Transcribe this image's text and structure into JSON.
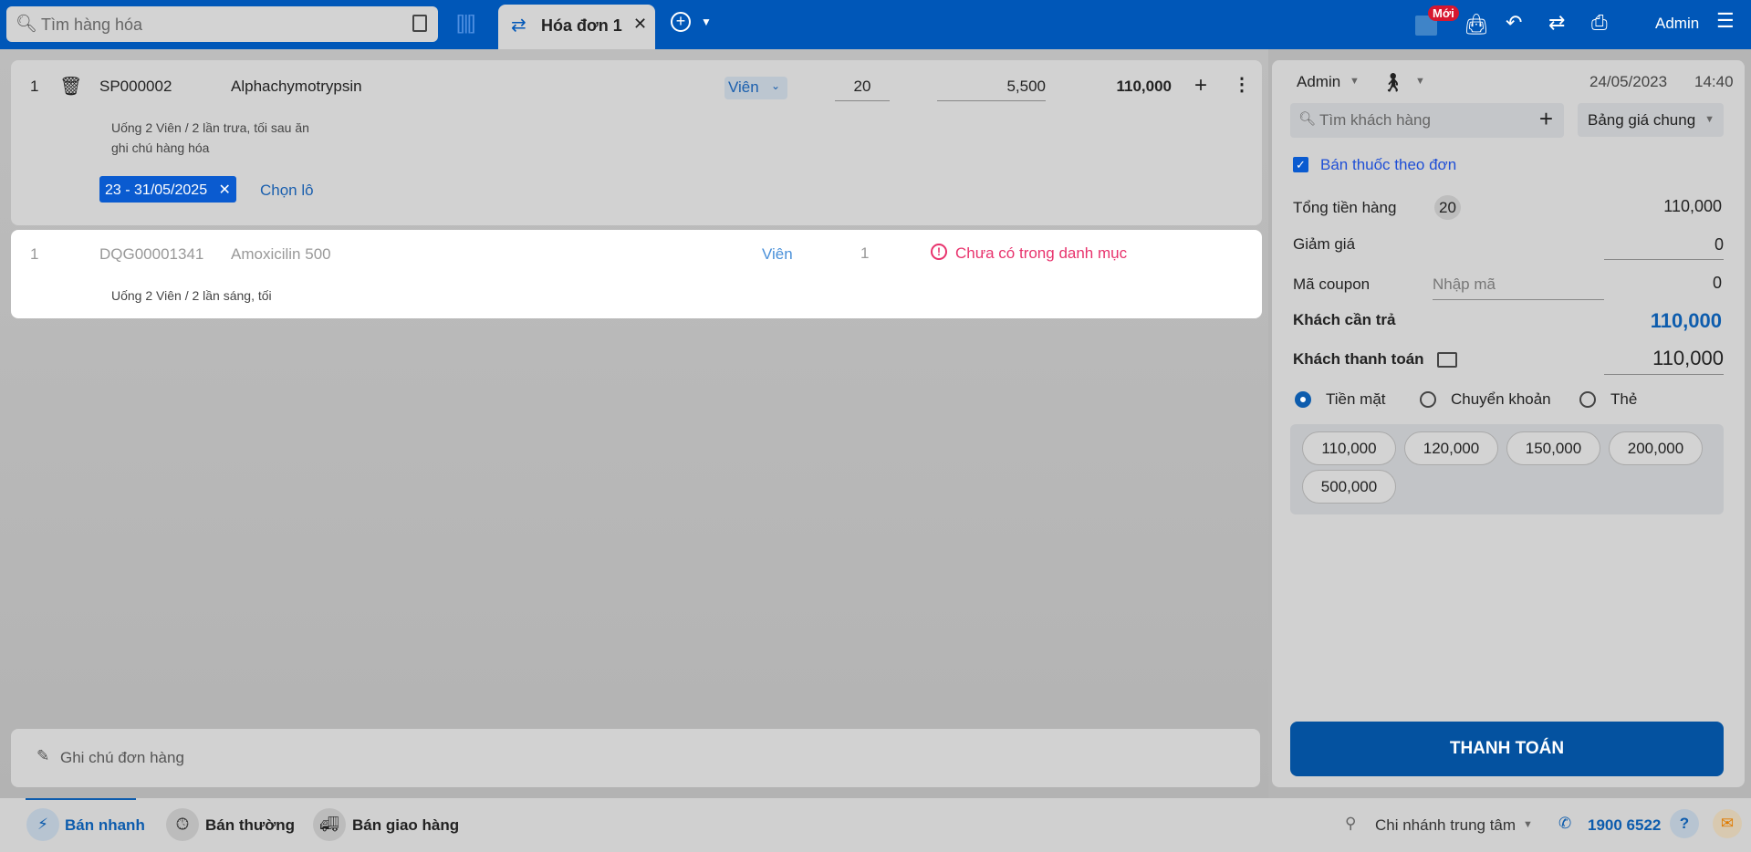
{
  "topbar": {
    "search_placeholder": "Tìm hàng hóa",
    "tab_label": "Hóa đơn 1",
    "new_badge": "Mới",
    "user": "Admin"
  },
  "items": [
    {
      "index": "1",
      "code": "SP000002",
      "name": "Alphachymotrypsin",
      "unit": "Viên",
      "qty": "20",
      "price": "5,500",
      "total": "110,000",
      "notes": [
        "Uống 2 Viên / 2 lần trưa, tối sau ăn",
        "ghi chú hàng hóa"
      ],
      "lot": "23 - 31/05/2025",
      "choose_lot": "Chọn lô"
    },
    {
      "index": "1",
      "code": "DQG00001341",
      "name": "Amoxicilin 500",
      "unit": "Viên",
      "qty": "1",
      "warning": "Chưa có trong danh mục",
      "note": "Uống 2 Viên / 2 lần sáng, tối"
    }
  ],
  "order_note_placeholder": "Ghi chú đơn hàng",
  "panel": {
    "seller": "Admin",
    "date": "24/05/2023",
    "time": "14:40",
    "customer_placeholder": "Tìm khách hàng",
    "price_list": "Bảng giá chung",
    "prescription_label": "Bán thuốc theo đơn",
    "subtotal_label": "Tổng tiền hàng",
    "item_count": "20",
    "subtotal": "110,000",
    "discount_label": "Giảm giá",
    "discount": "0",
    "coupon_label": "Mã coupon",
    "coupon_placeholder": "Nhập mã",
    "coupon_value": "0",
    "due_label": "Khách cần trả",
    "due": "110,000",
    "paid_label": "Khách thanh toán",
    "paid": "110,000",
    "methods": [
      "Tiền mặt",
      "Chuyển khoản",
      "Thẻ"
    ],
    "quick_amounts": [
      "110,000",
      "120,000",
      "150,000",
      "200,000",
      "500,000"
    ],
    "pay_button": "THANH TOÁN"
  },
  "bottom": {
    "modes": [
      "Bán nhanh",
      "Bán thường",
      "Bán giao hàng"
    ],
    "branch": "Chi nhánh trung tâm",
    "hotline": "1900 6522"
  },
  "colors": {
    "brand": "#0057b8",
    "danger": "#e8336d"
  }
}
